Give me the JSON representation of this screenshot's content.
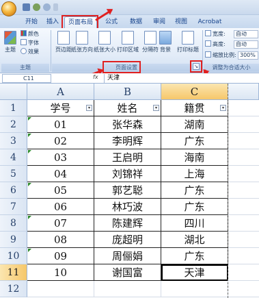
{
  "quick_access": {
    "icons": [
      "save-icon",
      "undo-icon",
      "redo-icon",
      "customize-icon"
    ]
  },
  "tabs": [
    {
      "label": "开始",
      "active": false
    },
    {
      "label": "插入",
      "active": false
    },
    {
      "label": "页面布局",
      "active": true
    },
    {
      "label": "公式",
      "active": false
    },
    {
      "label": "数据",
      "active": false
    },
    {
      "label": "审阅",
      "active": false
    },
    {
      "label": "视图",
      "active": false
    },
    {
      "label": "Acrobat",
      "active": false
    }
  ],
  "ribbon": {
    "themes": {
      "group_label": "主题",
      "theme_label": "主题",
      "colors": "颜色",
      "fonts": "字体",
      "effects": "效果"
    },
    "page_setup": {
      "group_label": "页面设置",
      "margins": "页边距",
      "orientation": "纸张方向",
      "size": "纸张大小",
      "print_area": "打印区域",
      "breaks": "分隔符",
      "background": "背景",
      "print_titles": "打印标题"
    },
    "scale": {
      "group_label": "调整为合适大小",
      "width_label": "宽度:",
      "width_value": "自动",
      "height_label": "高度:",
      "height_value": "自动",
      "scale_label": "缩放比例:",
      "scale_value": "300%"
    },
    "launcher_icon": "dialog-launcher-icon"
  },
  "formula_bar": {
    "name_box": "C11",
    "fx": "fx",
    "content": "天津"
  },
  "grid": {
    "columns": [
      "A",
      "B",
      "C"
    ],
    "selected_column": "C",
    "rows": [
      "1",
      "2",
      "3",
      "4",
      "5",
      "6",
      "7",
      "8",
      "9",
      "10",
      "11",
      "12"
    ],
    "selected_row": "11",
    "header": [
      "学号",
      "姓名",
      "籍贯"
    ],
    "data": [
      [
        "01",
        "张华森",
        "湖南"
      ],
      [
        "02",
        "李明辉",
        "广东"
      ],
      [
        "03",
        "王启明",
        "海南"
      ],
      [
        "04",
        "刘锦祥",
        "上海"
      ],
      [
        "05",
        "郭艺聪",
        "广东"
      ],
      [
        "06",
        "林巧波",
        "广东"
      ],
      [
        "07",
        "陈建辉",
        "四川"
      ],
      [
        "08",
        "庞超明",
        "湖北"
      ],
      [
        "09",
        "周俪娟",
        "广东"
      ],
      [
        "10",
        "谢国富",
        "天津"
      ]
    ],
    "filter_icon": "filter-dropdown-icon"
  },
  "colors": {
    "annotation_red": "#e02020",
    "selection": "#f6c76a",
    "ribbon_blue": "#c6d8ee"
  }
}
